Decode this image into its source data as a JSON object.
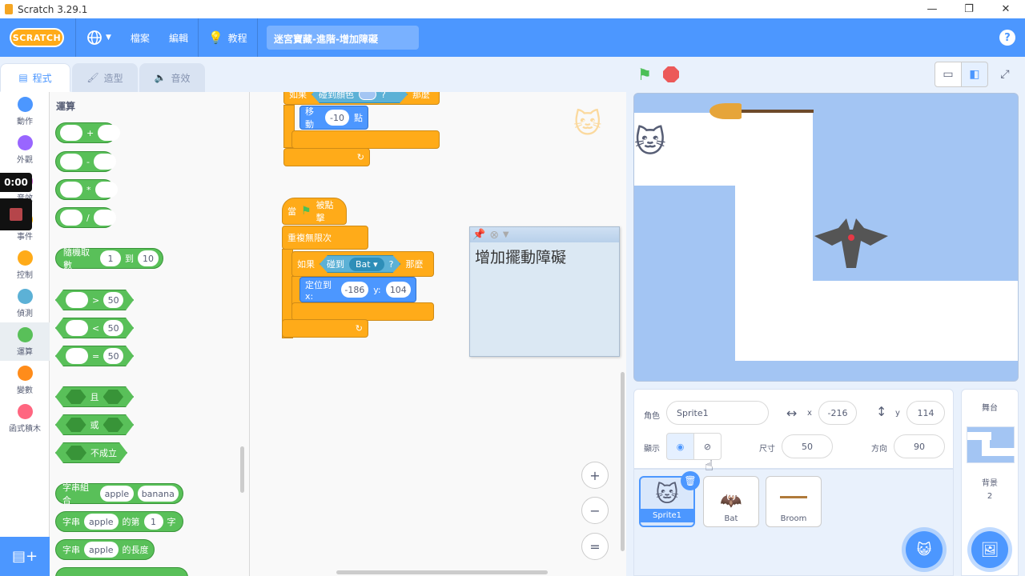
{
  "window": {
    "title": "Scratch 3.29.1",
    "minimize": "—",
    "restore": "❐",
    "close": "✕"
  },
  "menubar": {
    "logo": "SCRATCH",
    "language_icon": "globe-icon",
    "file": "檔案",
    "edit": "編輯",
    "tutorials": "教程",
    "project_title": "迷宮寶藏-進階-增加障礙",
    "help": "?"
  },
  "tabs": [
    {
      "label": "程式",
      "icon": "code-icon"
    },
    {
      "label": "造型",
      "icon": "brush-icon"
    },
    {
      "label": "音效",
      "icon": "speaker-icon"
    }
  ],
  "categories": [
    {
      "label": "動作",
      "color": "#4c97ff"
    },
    {
      "label": "外觀",
      "color": "#9966ff"
    },
    {
      "label": "音效",
      "color": "#cf63cf"
    },
    {
      "label": "事件",
      "color": "#ffbf00"
    },
    {
      "label": "控制",
      "color": "#ffab19"
    },
    {
      "label": "偵測",
      "color": "#5cb1d6"
    },
    {
      "label": "運算",
      "color": "#59c059"
    },
    {
      "label": "變數",
      "color": "#ff8c1a"
    },
    {
      "label": "函式積木",
      "color": "#ff6680"
    }
  ],
  "recorder": {
    "time": "0:00"
  },
  "palette": {
    "heading": "運算",
    "plus": "+",
    "minus": "-",
    "times": "*",
    "divide": "/",
    "random_label": "隨機取數",
    "random_from": "1",
    "random_to_label": "到",
    "random_to": "10",
    "gt": ">",
    "lt": "<",
    "eq": "=",
    "cmp_value": "50",
    "and": "且",
    "or": "或",
    "not": "不成立",
    "join_label": "字串組合",
    "join_a": "apple",
    "join_b": "banana",
    "letter_label": "字串",
    "letter_str": "apple",
    "letter_mid": "的第",
    "letter_idx": "1",
    "letter_end": "字",
    "length_label": "字串",
    "length_str": "apple",
    "length_end": "的長度"
  },
  "script1": {
    "if_label": "如果",
    "touching_color": "碰到顏色",
    "q": "?",
    "then": "那麼",
    "move_label": "移動",
    "move_value": "-10",
    "move_unit": "點"
  },
  "script2": {
    "hat": "當",
    "hat_end": "被點擊",
    "forever": "重複無限次",
    "if_label": "如果",
    "touching": "碰到",
    "target": "Bat",
    "q": "?",
    "then": "那麼",
    "goto_label": "定位到 x:",
    "x": "-186",
    "y_label": "y:",
    "y": "104"
  },
  "comment": {
    "text": "增加擺動障礙"
  },
  "zoom": {
    "in": "+",
    "out": "−",
    "reset": "="
  },
  "sprite_info": {
    "sprite_label": "角色",
    "sprite_name": "Sprite1",
    "x_label": "x",
    "x": "-216",
    "y_label": "y",
    "y": "114",
    "show_label": "顯示",
    "size_label": "尺寸",
    "size": "50",
    "direction_label": "方向",
    "direction": "90"
  },
  "sprites": [
    {
      "name": "Sprite1",
      "selected": true
    },
    {
      "name": "Bat",
      "selected": false
    },
    {
      "name": "Broom",
      "selected": false
    }
  ],
  "stage_panel": {
    "title": "舞台",
    "backdrops_label": "背景",
    "backdrops_count": "2"
  }
}
